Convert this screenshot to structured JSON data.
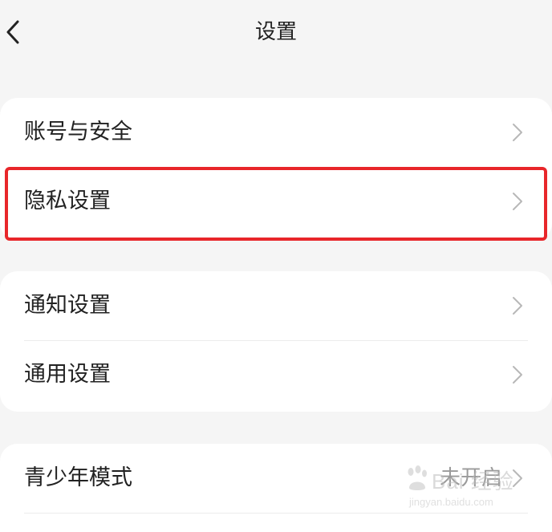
{
  "header": {
    "title": "设置",
    "back_icon": "chevron-left-icon"
  },
  "sections": [
    {
      "items": [
        {
          "label": "账号与安全",
          "icon": "chevron-right-icon"
        },
        {
          "label": "隐私设置",
          "icon": "chevron-right-icon",
          "highlighted": true
        }
      ]
    },
    {
      "items": [
        {
          "label": "通知设置",
          "icon": "chevron-right-icon"
        },
        {
          "label": "通用设置",
          "icon": "chevron-right-icon"
        }
      ]
    },
    {
      "items": [
        {
          "label": "青少年模式",
          "value": "未开启",
          "icon": "chevron-right-icon"
        }
      ]
    }
  ],
  "highlight_color": "#e8262a",
  "watermark": {
    "text": "Bai 经验",
    "url": "jingyan.baidu.com"
  }
}
